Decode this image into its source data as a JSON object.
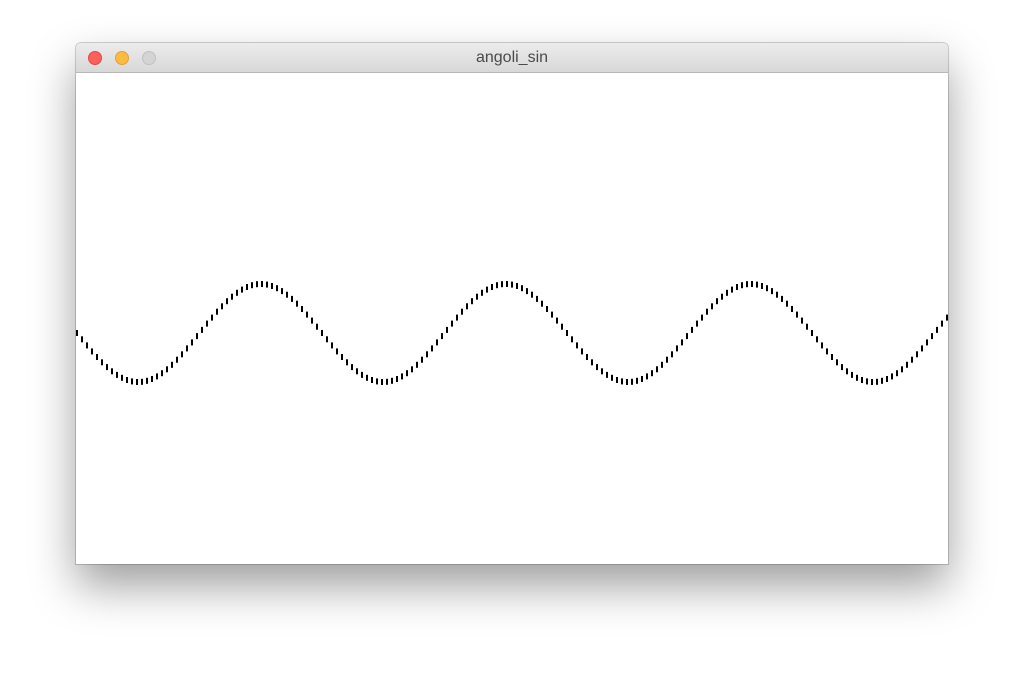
{
  "window": {
    "title": "angoli_sin",
    "buttons": {
      "close_color": "#fc605b",
      "minimize_color": "#fdbc40",
      "zoom_color": "#d4d4d4"
    }
  },
  "canvas": {
    "background": "#ffffff",
    "mark_color": "#000000",
    "waves_visible": 3.5
  }
}
